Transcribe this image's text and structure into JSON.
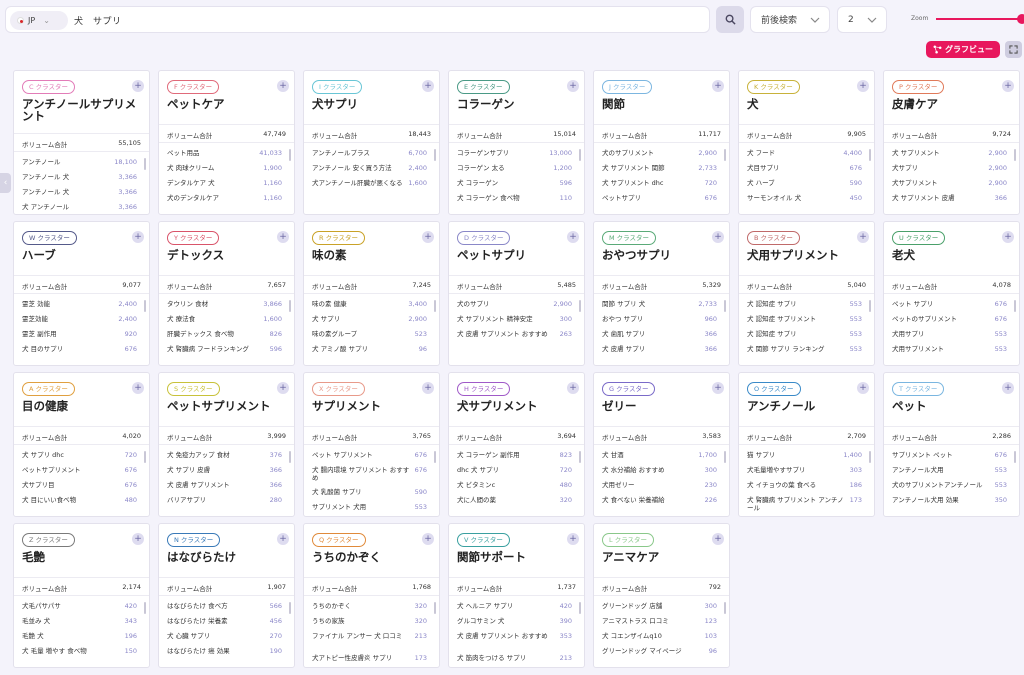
{
  "search": {
    "country": "JP",
    "query": "犬　サプリ",
    "mode": "前後検索",
    "depth": "2"
  },
  "zoom": {
    "label": "Zoom",
    "level": 1.0
  },
  "graph_button": {
    "label": "グラフビュー"
  },
  "colors": {
    "accent": "#e8175d",
    "keyword_value": "#8a86c8"
  },
  "volume_label": "ボリューム合計",
  "cards": [
    {
      "badge": "C クラスター",
      "color": "#e27cb8",
      "title": "アンチノールサプリメント",
      "volume": "55,105",
      "keywords": [
        [
          "アンチノール",
          "18,100"
        ],
        [
          "アンチノール 犬",
          "3,366"
        ],
        [
          "アンチノール 犬",
          "3,366"
        ],
        [
          "犬 アンチノール",
          "3,366"
        ]
      ]
    },
    {
      "badge": "F クラスター",
      "color": "#e06a7a",
      "title": "ペットケア",
      "volume": "47,749",
      "keywords": [
        [
          "ペット用品",
          "41,033"
        ],
        [
          "犬 肉球クリーム",
          "1,900"
        ],
        [
          "デンタルケア 犬",
          "1,160"
        ],
        [
          "犬のデンタルケア",
          "1,160"
        ]
      ]
    },
    {
      "badge": "I クラスター",
      "color": "#69c6d6",
      "title": "犬サプリ",
      "volume": "18,443",
      "keywords": [
        [
          "アンチノールプラス",
          "6,700"
        ],
        [
          "アンチノール 安く買う方法",
          "2,400"
        ],
        [
          "犬アンチノール肝臓が悪くなる",
          "1,600"
        ]
      ]
    },
    {
      "badge": "E クラスター",
      "color": "#4a9a86",
      "title": "コラーゲン",
      "volume": "15,014",
      "keywords": [
        [
          "コラーゲンサプリ",
          "13,000"
        ],
        [
          "コラーゲン 太る",
          "1,200"
        ],
        [
          "犬 コラーゲン",
          "596"
        ],
        [
          "犬 コラーゲン 食べ物",
          "110"
        ]
      ]
    },
    {
      "badge": "J クラスター",
      "color": "#7cb6e0",
      "title": "関節",
      "volume": "11,717",
      "keywords": [
        [
          "犬のサプリメント",
          "2,900"
        ],
        [
          "犬 サプリメント 関節",
          "2,733"
        ],
        [
          "犬 サプリメント dhc",
          "720"
        ],
        [
          "ペットサプリ",
          "676"
        ]
      ]
    },
    {
      "badge": "K クラスター",
      "color": "#c8b23a",
      "title": "犬",
      "volume": "9,905",
      "keywords": [
        [
          "犬 フード",
          "4,400"
        ],
        [
          "犬目サプリ",
          "676"
        ],
        [
          "犬 ハーブ",
          "590"
        ],
        [
          "サーモンオイル 犬",
          "450"
        ]
      ]
    },
    {
      "badge": "P クラスター",
      "color": "#e07a5a",
      "title": "皮膚ケア",
      "volume": "9,724",
      "keywords": [
        [
          "犬 サプリメント",
          "2,900"
        ],
        [
          "犬サプリ",
          "2,900"
        ],
        [
          "犬サプリメント",
          "2,900"
        ],
        [
          "犬 サプリメント 皮膚",
          "366"
        ]
      ]
    },
    {
      "badge": "W クラスター",
      "color": "#555a8a",
      "title": "ハーブ",
      "volume": "9,077",
      "keywords": [
        [
          "霊芝 効能",
          "2,400"
        ],
        [
          "霊芝効能",
          "2,400"
        ],
        [
          "霊芝 副作用",
          "920"
        ],
        [
          "犬 目のサプリ",
          "676"
        ]
      ]
    },
    {
      "badge": "Y クラスター",
      "color": "#d9546a",
      "title": "デトックス",
      "volume": "7,657",
      "keywords": [
        [
          "タウリン 食材",
          "3,866"
        ],
        [
          "犬 療法食",
          "1,600"
        ],
        [
          "肝臓デトックス 食べ物",
          "826"
        ],
        [
          "犬 腎臓病 フードランキング",
          "596"
        ]
      ]
    },
    {
      "badge": "R クラスター",
      "color": "#c9a227",
      "title": "味の素",
      "volume": "7,245",
      "keywords": [
        [
          "味の素 健康",
          "3,400"
        ],
        [
          "犬 サプリ",
          "2,900"
        ],
        [
          "味の素グループ",
          "523"
        ],
        [
          "犬 アミノ酸 サプリ",
          "96"
        ]
      ]
    },
    {
      "badge": "D クラスター",
      "color": "#8a88c8",
      "title": "ペットサプリ",
      "volume": "5,485",
      "keywords": [
        [
          "犬のサプリ",
          "2,900"
        ],
        [
          "犬 サプリメント 精神安定",
          "300"
        ],
        [
          "犬 皮膚 サプリメント おすすめ",
          "263"
        ]
      ]
    },
    {
      "badge": "M クラスター",
      "color": "#5aaa78",
      "title": "おやつサプリ",
      "volume": "5,329",
      "keywords": [
        [
          "関節 サプリ 犬",
          "2,733"
        ],
        [
          "おやつ サプリ",
          "960"
        ],
        [
          "犬 歯肌 サプリ",
          "366"
        ],
        [
          "犬 皮膚 サプリ",
          "366"
        ]
      ]
    },
    {
      "badge": "B クラスター",
      "color": "#c06a6a",
      "title": "犬用サプリメント",
      "volume": "5,040",
      "keywords": [
        [
          "犬 認知症 サプリ",
          "553"
        ],
        [
          "犬 認知症 サプリメント",
          "553"
        ],
        [
          "犬 認知症 サプリ",
          "553"
        ],
        [
          "犬 関節 サプリ ランキング",
          "553"
        ]
      ]
    },
    {
      "badge": "U クラスター",
      "color": "#4aa06a",
      "title": "老犬",
      "volume": "4,078",
      "keywords": [
        [
          "ペット サプリ",
          "676"
        ],
        [
          "ペットのサプリメント",
          "676"
        ],
        [
          "犬用サプリ",
          "553"
        ],
        [
          "犬用サプリメント",
          "553"
        ]
      ]
    },
    {
      "badge": "A クラスター",
      "color": "#e0a040",
      "title": "目の健康",
      "volume": "4,020",
      "keywords": [
        [
          "犬 サプリ dhc",
          "720"
        ],
        [
          "ペットサプリメント",
          "676"
        ],
        [
          "犬サプリ目",
          "676"
        ],
        [
          "犬 目にいい食べ物",
          "480"
        ]
      ]
    },
    {
      "badge": "S クラスター",
      "color": "#c8c23a",
      "title": "ペットサプリメント",
      "volume": "3,999",
      "keywords": [
        [
          "犬 免疫力アップ 食材",
          "376"
        ],
        [
          "犬 サプリ 皮膚",
          "366"
        ],
        [
          "犬 皮膚 サプリメント",
          "366"
        ],
        [
          "バリアサプリ",
          "280"
        ]
      ]
    },
    {
      "badge": "X クラスター",
      "color": "#e89a8a",
      "title": "サプリメント",
      "volume": "3,765",
      "keywords": [
        [
          "ペット サプリメント",
          "676"
        ],
        [
          "犬 腸内環境 サプリメント おすすめ",
          "676"
        ],
        [
          "犬 乳酸菌 サプリ",
          "590"
        ],
        [
          "サプリメント 犬用",
          "553"
        ]
      ]
    },
    {
      "badge": "H クラスター",
      "color": "#a05ac8",
      "title": "犬サプリメント",
      "volume": "3,694",
      "keywords": [
        [
          "犬 コラーゲン 副作用",
          "823"
        ],
        [
          "dhc 犬 サプリ",
          "720"
        ],
        [
          "犬 ビタミンc",
          "480"
        ],
        [
          "犬に人間の薬",
          "320"
        ]
      ]
    },
    {
      "badge": "G クラスター",
      "color": "#7a6ac8",
      "title": "ゼリー",
      "volume": "3,583",
      "keywords": [
        [
          "犬 甘酒",
          "1,700"
        ],
        [
          "犬 水分補給 おすすめ",
          "300"
        ],
        [
          "犬用ゼリー",
          "230"
        ],
        [
          "犬 食べない 栄養補給",
          "226"
        ]
      ]
    },
    {
      "badge": "O クラスター",
      "color": "#3a8ac8",
      "title": "アンチノール",
      "volume": "2,709",
      "keywords": [
        [
          "猫 サプリ",
          "1,400"
        ],
        [
          "犬毛量増やすサプリ",
          "303"
        ],
        [
          "犬 イチョウの葉 食べる",
          "186"
        ],
        [
          "犬 腎臓病 サプリメント アンチノール",
          "173"
        ]
      ]
    },
    {
      "badge": "T クラスター",
      "color": "#7ab6e0",
      "title": "ペット",
      "volume": "2,286",
      "keywords": [
        [
          "サプリメント ペット",
          "676"
        ],
        [
          "アンチノール犬用",
          "553"
        ],
        [
          "犬のサプリメントアンチノール",
          "553"
        ],
        [
          "アンチノール犬用 効果",
          "350"
        ]
      ]
    },
    {
      "badge": "Z クラスター",
      "color": "#7a7a7a",
      "title": "毛艶",
      "volume": "2,174",
      "keywords": [
        [
          "犬毛パサパサ",
          "420"
        ],
        [
          "毛並み 犬",
          "343"
        ],
        [
          "毛艶 犬",
          "196"
        ],
        [
          "犬 毛量 増やす 食べ物",
          "150"
        ]
      ]
    },
    {
      "badge": "N クラスター",
      "color": "#3a7ab8",
      "title": "はなびらたけ",
      "volume": "1,907",
      "keywords": [
        [
          "はなびらたけ 食べ方",
          "566"
        ],
        [
          "はなびらたけ 栄養素",
          "456"
        ],
        [
          "犬 心臓 サプリ",
          "270"
        ],
        [
          "はなびらたけ 癌 効果",
          "190"
        ]
      ]
    },
    {
      "badge": "Q クラスター",
      "color": "#e08a3a",
      "title": "うちのかぞく",
      "volume": "1,768",
      "keywords": [
        [
          "うちのかぞく",
          "320"
        ],
        [
          "うちの家族",
          "320"
        ],
        [
          "ファイナル アンサー 犬 口コミ",
          "213"
        ],
        [
          "犬アトピー性皮膚炎 サプリ",
          "173"
        ]
      ]
    },
    {
      "badge": "V クラスター",
      "color": "#3aa0a0",
      "title": "関節サポート",
      "volume": "1,737",
      "keywords": [
        [
          "犬 ヘルニア サプリ",
          "420"
        ],
        [
          "グルコサミン 犬",
          "390"
        ],
        [
          "犬 皮膚 サプリメント おすすめ",
          "353"
        ],
        [
          "犬 筋肉をつける サプリ",
          "213"
        ]
      ]
    },
    {
      "badge": "L クラスター",
      "color": "#8ac88a",
      "title": "アニマケア",
      "volume": "792",
      "keywords": [
        [
          "グリーンドッグ 店舗",
          "300"
        ],
        [
          "アニマストラス 口コミ",
          "123"
        ],
        [
          "犬 コエンザイムq10",
          "103"
        ],
        [
          "グリーンドッグ マイページ",
          "96"
        ]
      ]
    }
  ]
}
